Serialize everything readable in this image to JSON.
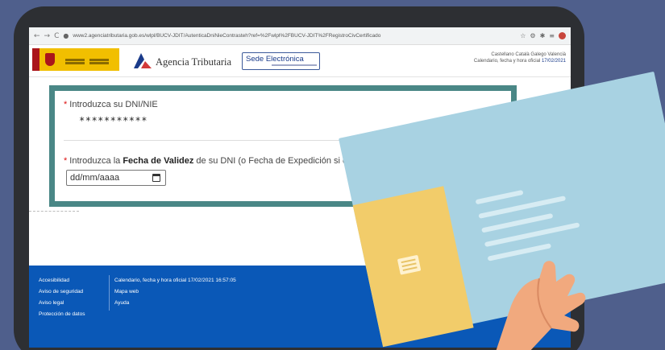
{
  "browser": {
    "url": "www2.agenciatributaria.gob.es/wlpl/BUCV-JDIT/AutenticaDniNieContrasteh?ref=%2Fwlpl%2FBUCV-JDIT%2FRegistroCivCertificado"
  },
  "header": {
    "agency_name": "Agencia Tributaria",
    "sede_label": "Sede Electrónica",
    "languages": "Castellano   Català   Galego   Valencià",
    "date_label": "Calendario, fecha y hora oficial",
    "date_value": "17/02/2021"
  },
  "form": {
    "field1_label": "Introduzca su DNI/NIE",
    "field1_value": "***********",
    "field2_prefix": "Introduzca la ",
    "field2_bold": "Fecha de Validez",
    "field2_suffix": " de su DNI (o Fecha de Expedición si es un DNI Permanente)",
    "field2_placeholder": "dd/mm/aaaa",
    "required_mark": "*"
  },
  "footer": {
    "col1": [
      "Accesibilidad",
      "Aviso de seguridad",
      "Aviso legal",
      "Protección de datos"
    ],
    "col2": [
      "Calendario, fecha y hora oficial 17/02/2021 16:57:05",
      "Mapa web",
      "Ayuda"
    ]
  },
  "colors": {
    "card_border": "#4a8786",
    "footer_bg": "#0a58b7",
    "background": "#4f5f8c"
  }
}
